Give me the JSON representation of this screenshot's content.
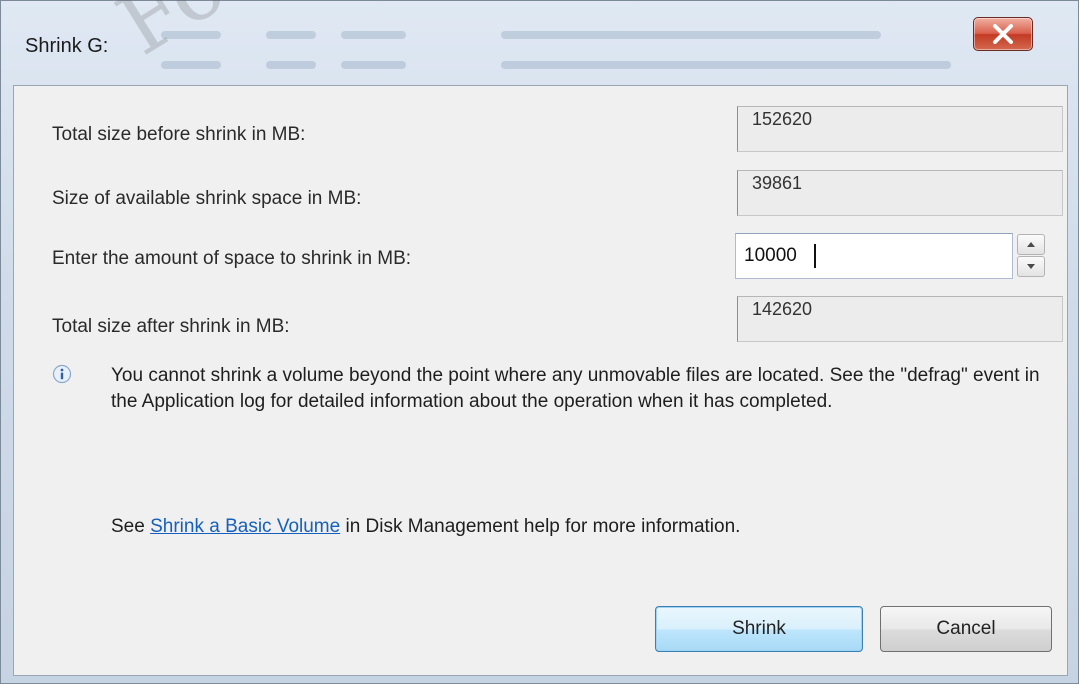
{
  "window": {
    "title": "Shrink G:",
    "close_glyph": "X",
    "close_color": "#c23a24"
  },
  "fields": {
    "total_before_label": "Total size before shrink in MB:",
    "total_before_value": "152620",
    "available_label": "Size of available shrink space in MB:",
    "available_value": "39861",
    "amount_label": "Enter the amount of space to shrink in MB:",
    "amount_value": "10000",
    "total_after_label": "Total size after shrink in MB:",
    "total_after_value": "142620"
  },
  "info": {
    "icon": "info-icon",
    "message": "You cannot shrink a volume beyond the point where any unmovable files are located. See the \"defrag\" event in the Application log for detailed information about the operation when it has completed."
  },
  "help": {
    "prefix": "See ",
    "link_text": "Shrink a Basic Volume",
    "suffix": " in Disk Management help for more information.",
    "link_color": "#1560bd"
  },
  "buttons": {
    "shrink": "Shrink",
    "cancel": "Cancel"
  },
  "watermark": {
    "text": "For E"
  }
}
